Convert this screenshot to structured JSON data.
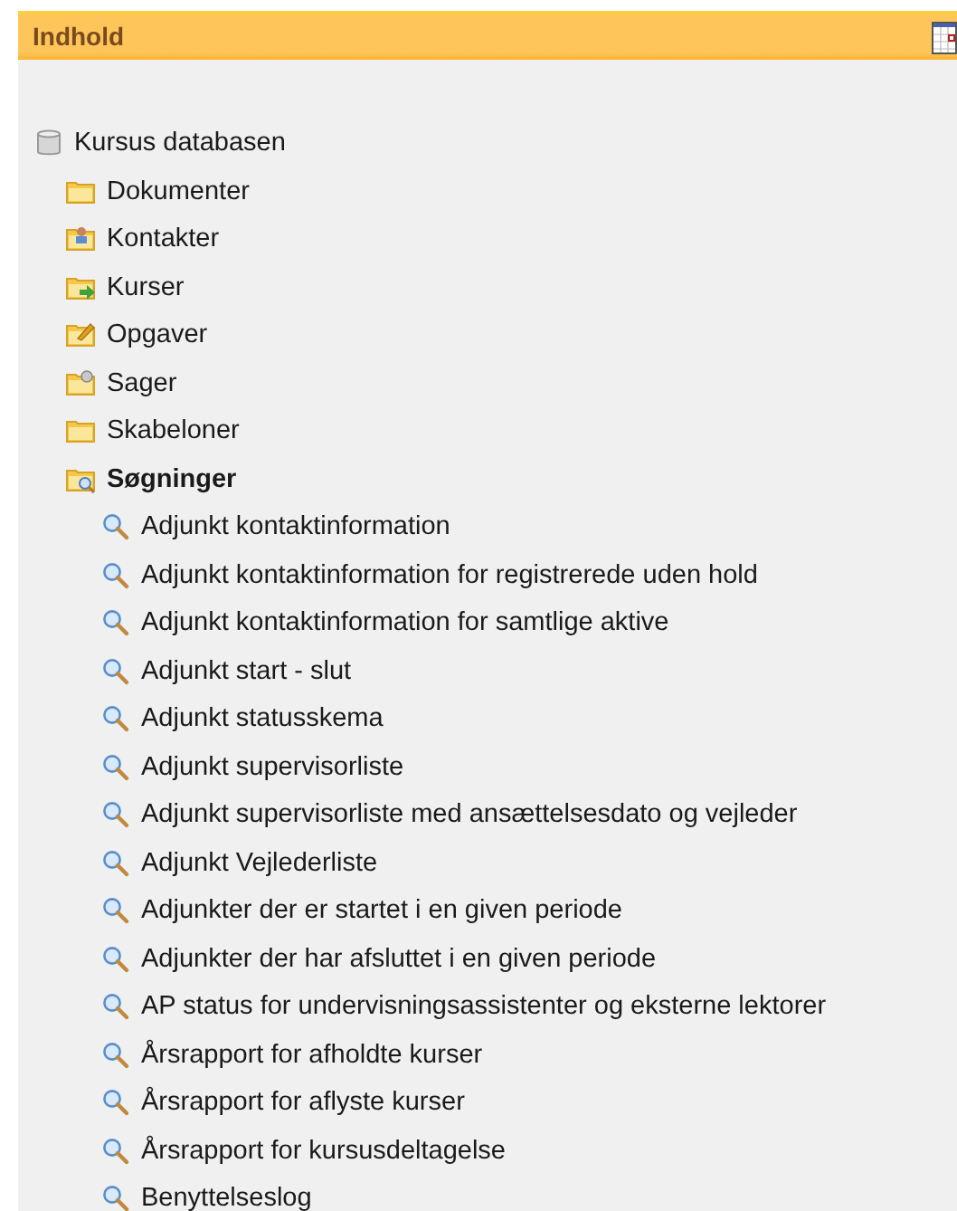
{
  "panel": {
    "title": "Indhold"
  },
  "tree": {
    "label": "Kursus databasen",
    "children": [
      {
        "label": "Dokumenter",
        "kind": "folder",
        "selected": false
      },
      {
        "label": "Kontakter",
        "kind": "contacts",
        "selected": false
      },
      {
        "label": "Kurser",
        "kind": "courses",
        "selected": false
      },
      {
        "label": "Opgaver",
        "kind": "tasks",
        "selected": false
      },
      {
        "label": "Sager",
        "kind": "cases",
        "selected": false
      },
      {
        "label": "Skabeloner",
        "kind": "folder",
        "selected": false
      },
      {
        "label": "Søgninger",
        "kind": "searches",
        "selected": true,
        "children": [
          {
            "label": "Adjunkt kontaktinformation"
          },
          {
            "label": "Adjunkt kontaktinformation for registrerede uden hold"
          },
          {
            "label": "Adjunkt kontaktinformation for samtlige aktive"
          },
          {
            "label": "Adjunkt start - slut"
          },
          {
            "label": "Adjunkt statusskema"
          },
          {
            "label": "Adjunkt supervisorliste"
          },
          {
            "label": "Adjunkt supervisorliste med ansættelsesdato og vejleder"
          },
          {
            "label": "Adjunkt Vejlederliste"
          },
          {
            "label": "Adjunkter der er startet i en given periode"
          },
          {
            "label": "Adjunkter der har afsluttet i en given periode"
          },
          {
            "label": "AP status for undervisningsassistenter og eksterne lektorer"
          },
          {
            "label": "Årsrapport for afholdte kurser"
          },
          {
            "label": "Årsrapport for aflyste kurser"
          },
          {
            "label": "Årsrapport for kursusdeltagelse"
          },
          {
            "label": "Benyttelseslog"
          }
        ]
      }
    ]
  }
}
